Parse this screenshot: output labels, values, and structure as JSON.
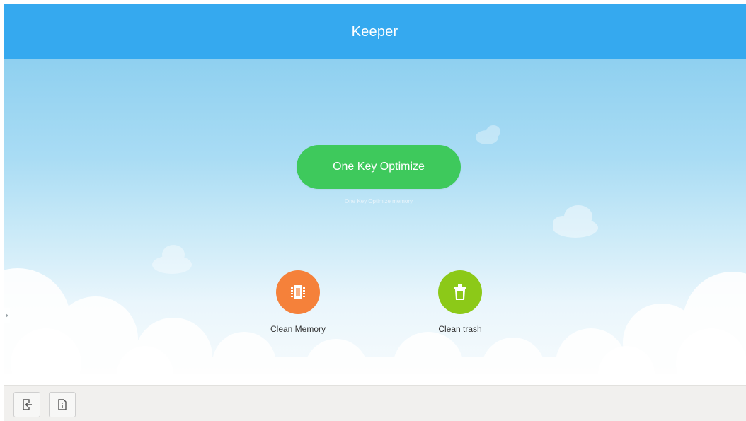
{
  "app": {
    "title": "Keeper"
  },
  "optimize": {
    "button_label": "One Key Optimize",
    "subtitle": "One Key Optimize memory"
  },
  "actions": [
    {
      "label": "Clean Memory",
      "icon": "memory-chip-icon",
      "color": "#f5813a"
    },
    {
      "label": "Clean trash",
      "icon": "trash-can-icon",
      "color": "#8cc918"
    }
  ],
  "bottom_bar": {
    "buttons": [
      {
        "icon": "exit-icon"
      },
      {
        "icon": "info-icon"
      }
    ]
  },
  "colors": {
    "header": "#35a9ef",
    "optimize_button": "#3ec95c",
    "bottom_bar": "#f1f0ee"
  }
}
